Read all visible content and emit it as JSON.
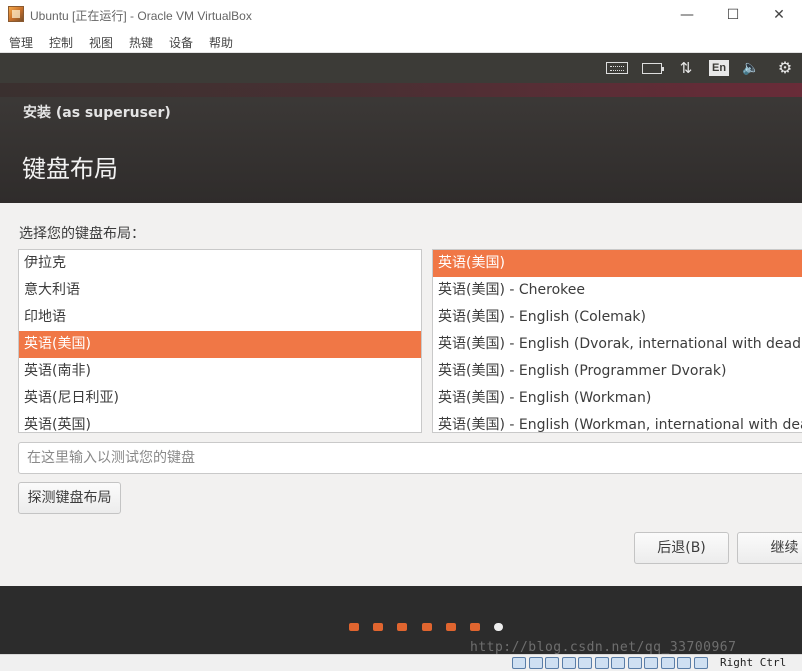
{
  "window": {
    "title": "Ubuntu [正在运行] - Oracle VM VirtualBox",
    "minimize_glyph": "—",
    "maximize_glyph": "☐",
    "close_glyph": "✕"
  },
  "menubar": {
    "items": [
      "管理",
      "控制",
      "视图",
      "热键",
      "设备",
      "帮助"
    ]
  },
  "panel": {
    "language": "En",
    "icons": [
      "keyboard-icon",
      "battery-icon",
      "network-icon",
      "language-indicator",
      "volume-icon",
      "gear-icon"
    ],
    "network_glyph": "⇅",
    "volume_glyph": "🔈",
    "gear_glyph": "⚙"
  },
  "header": {
    "subtitle": "安装 (as superuser)",
    "title": "键盘布局"
  },
  "content": {
    "prompt": "选择您的键盘布局：",
    "left_list": {
      "items": [
        "伊拉克",
        "意大利语",
        "印地语",
        "英语(美国)",
        "英语(南非)",
        "英语(尼日利亚)",
        "英语(英国)"
      ],
      "selected_index": 3
    },
    "right_list": {
      "items": [
        "英语(美国)",
        "英语(美国) - Cherokee",
        "英语(美国) - English (Colemak)",
        "英语(美国) - English (Dvorak, international with dead keys)",
        "英语(美国) - English (Programmer Dvorak)",
        "英语(美国) - English (Workman)",
        "英语(美国) - English (Workman, international with dead keys)"
      ],
      "selected_index": 0
    },
    "test_input": {
      "value": "",
      "placeholder": "在这里输入以测试您的键盘"
    },
    "detect_button": "探测键盘布局",
    "back_button": "后退(B)",
    "continue_button": "继续"
  },
  "progress": {
    "total_steps": 7,
    "current_step": 7
  },
  "footer": {
    "watermark": "http://blog.csdn.net/qq_33700967"
  },
  "statusbar": {
    "host_key": "Right Ctrl",
    "icon_count": 12
  },
  "colors": {
    "accent": "#f07746",
    "panel": "#3c3b37",
    "header": "#2f2c2b",
    "dot": "#e0652f",
    "background": "#f2f1f0"
  }
}
